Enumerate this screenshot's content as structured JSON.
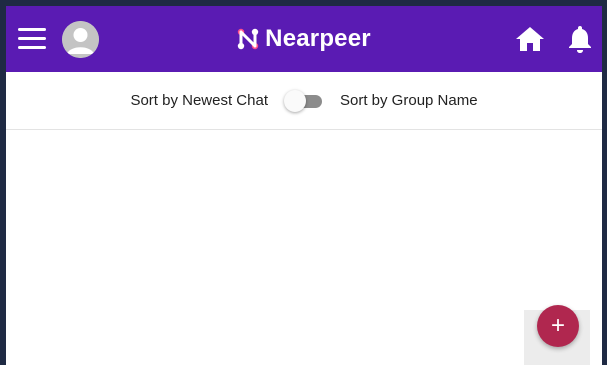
{
  "app_bar": {
    "brand_name": "Nearpeer",
    "background_color": "#5a1bb3",
    "menu_icon": "hamburger-menu-icon",
    "avatar_icon": "user-avatar-icon",
    "logo_icon": "nearpeer-logo-icon",
    "home_icon": "home-icon",
    "notifications_icon": "bell-icon"
  },
  "sort_bar": {
    "left_label": "Sort by Newest Chat",
    "right_label": "Sort by Group Name",
    "toggle_state": "off"
  },
  "fab": {
    "label": "+",
    "icon": "plus-icon",
    "color": "#b0274f"
  }
}
